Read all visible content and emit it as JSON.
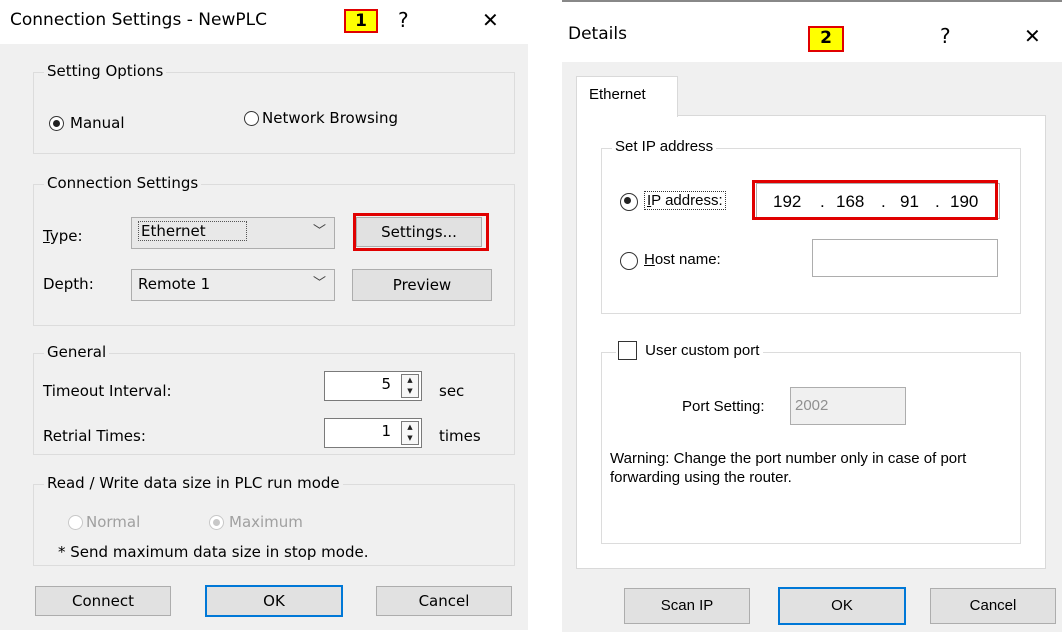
{
  "dialog1": {
    "title": "Connection Settings - NewPLC",
    "badge": "1",
    "help": "?",
    "close": "✕",
    "setting_options": {
      "legend": "Setting Options",
      "manual": "Manual",
      "network_browsing": "Network Browsing"
    },
    "connection_settings": {
      "legend": "Connection Settings",
      "type_label": "Type:",
      "type_value": "Ethernet",
      "settings_button": "Settings...",
      "depth_label": "Depth:",
      "depth_value": "Remote 1",
      "preview_button": "Preview"
    },
    "general": {
      "legend": "General",
      "timeout_label": "Timeout Interval:",
      "timeout_value": "5",
      "timeout_unit": "sec",
      "retrial_label": "Retrial Times:",
      "retrial_value": "1",
      "retrial_unit": "times"
    },
    "rw_size": {
      "legend": "Read / Write data size in PLC run mode",
      "normal": "Normal",
      "maximum": "Maximum",
      "note": "* Send maximum data size in stop mode."
    },
    "buttons": {
      "connect": "Connect",
      "ok": "OK",
      "cancel": "Cancel"
    }
  },
  "dialog2": {
    "title": "Details",
    "badge": "2",
    "help": "?",
    "close": "✕",
    "tab": "Ethernet",
    "set_ip": {
      "legend": "Set IP address",
      "ip_label": "IP address:",
      "ip_octets": [
        "192",
        "168",
        "91",
        "190"
      ],
      "host_label": "Host name:",
      "host_value": ""
    },
    "custom_port": {
      "label": "User custom port",
      "port_label": "Port Setting:",
      "port_value": "2002",
      "warning": "Warning: Change the port number only in case of port forwarding using the router."
    },
    "buttons": {
      "scan": "Scan IP",
      "ok": "OK",
      "cancel": "Cancel"
    }
  }
}
